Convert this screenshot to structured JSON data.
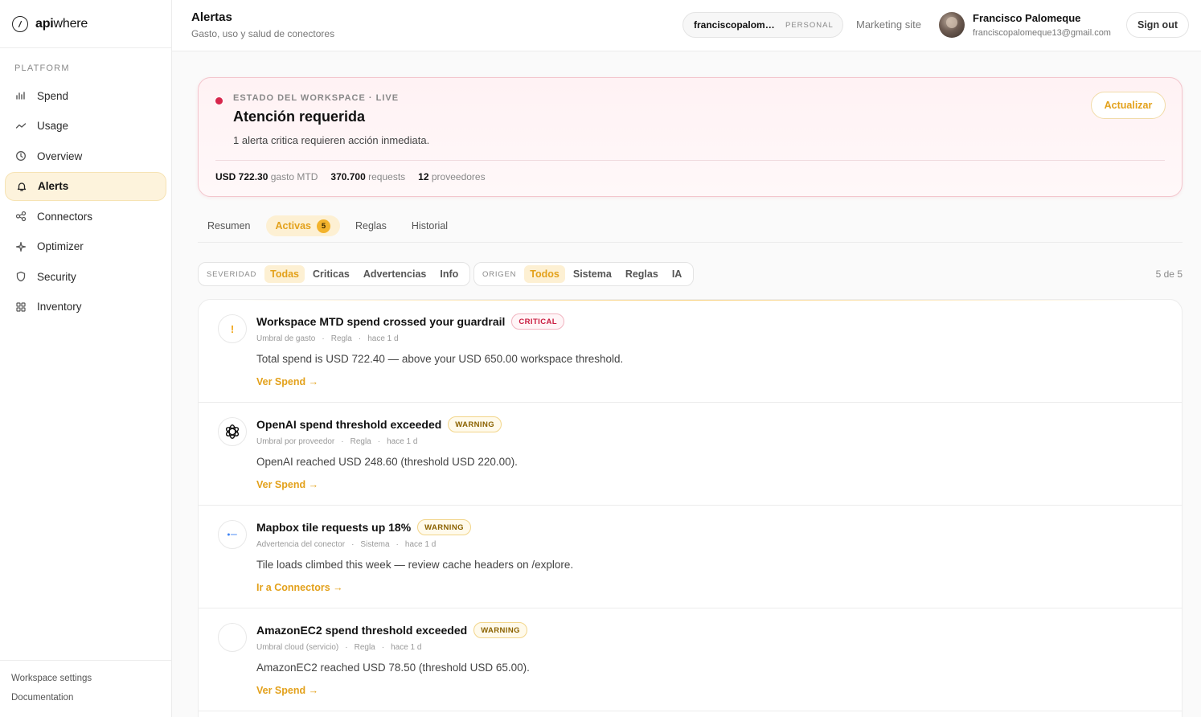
{
  "brand": {
    "api": "api",
    "where": "where"
  },
  "sidebar": {
    "section": "PLATFORM",
    "items": [
      {
        "label": "Spend",
        "icon": "bar-chart-icon"
      },
      {
        "label": "Usage",
        "icon": "trend-line-icon"
      },
      {
        "label": "Overview",
        "icon": "clock-icon"
      },
      {
        "label": "Alerts",
        "icon": "bell-icon",
        "active": true
      },
      {
        "label": "Connectors",
        "icon": "connectors-icon"
      },
      {
        "label": "Optimizer",
        "icon": "sparkle-icon"
      },
      {
        "label": "Security",
        "icon": "shield-icon"
      },
      {
        "label": "Inventory",
        "icon": "grid-icon"
      }
    ],
    "footer": {
      "settings": "Workspace settings",
      "docs": "Documentation"
    }
  },
  "header": {
    "title": "Alertas",
    "subtitle": "Gasto, uso y salud de conectores",
    "workspace_name": "franciscopalome...",
    "workspace_tag": "PERSONAL",
    "marketing": "Marketing site",
    "user_name": "Francisco Palomeque",
    "user_email": "franciscopalomeque13@gmail.com",
    "sign_out": "Sign out"
  },
  "banner": {
    "eyebrow": "ESTADO DEL WORKSPACE · LIVE",
    "title": "Atención requerida",
    "description": "1 alerta critica requieren acción inmediata.",
    "spend_value": "USD 722.30",
    "spend_label": "gasto MTD",
    "requests_value": "370.700",
    "requests_label": "requests",
    "providers_value": "12",
    "providers_label": "proveedores",
    "refresh": "Actualizar",
    "status_color": "#d7264c"
  },
  "tabs": {
    "resumen": "Resumen",
    "activas": "Activas",
    "activas_count": "5",
    "reglas": "Reglas",
    "historial": "Historial"
  },
  "filters": {
    "severity_label": "SEVERIDAD",
    "severity": [
      "Todas",
      "Criticas",
      "Advertencias",
      "Info"
    ],
    "origin_label": "ORIGEN",
    "origin": [
      "Todos",
      "Sistema",
      "Reglas",
      "IA"
    ],
    "count": "5 de 5"
  },
  "accent_color": "#e3a11b",
  "alerts": [
    {
      "icon": "exclamation-icon",
      "icon_text": "!",
      "title": "Workspace MTD spend crossed your guardrail",
      "severity": "CRITICAL",
      "category": "Umbral de gasto",
      "origin": "Regla",
      "time": "hace 1 d",
      "description": "Total spend is USD 722.40 — above your USD 650.00 workspace threshold.",
      "link": "Ver Spend →"
    },
    {
      "icon": "openai-logo-icon",
      "title": "OpenAI spend threshold exceeded",
      "severity": "WARNING",
      "category": "Umbral por proveedor",
      "origin": "Regla",
      "time": "hace 1 d",
      "description": "OpenAI reached USD 248.60 (threshold USD 220.00).",
      "link": "Ver Spend →"
    },
    {
      "icon": "mapbox-logo-icon",
      "title": "Mapbox tile requests up 18%",
      "severity": "WARNING",
      "category": "Advertencia del conector",
      "origin": "Sistema",
      "time": "hace 1 d",
      "description": "Tile loads climbed this week — review cache headers on /explore.",
      "link": "Ir a Connectors →"
    },
    {
      "icon": "aws-logo-icon",
      "title": "AmazonEC2 spend threshold exceeded",
      "severity": "WARNING",
      "category": "Umbral cloud (servicio)",
      "origin": "Regla",
      "time": "hace 1 d",
      "description": "AmazonEC2 reached USD 78.50 (threshold USD 65.00).",
      "link": "Ver Spend →"
    }
  ]
}
